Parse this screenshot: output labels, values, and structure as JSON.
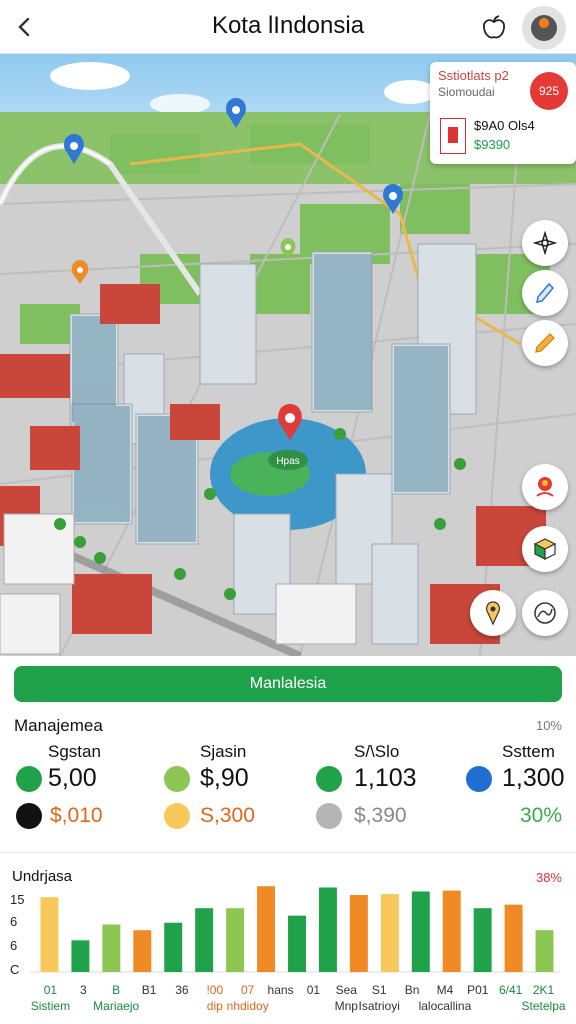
{
  "header": {
    "back_icon": "chevron-left-icon",
    "title": "Kota lIndonsia",
    "apple_icon": "apple-icon",
    "avatar_icon": "avatar-icon"
  },
  "map": {
    "center_pin_label": "Hpas",
    "info_card": {
      "title": "Sstiotlats p2",
      "subtitle": "Siomoudai",
      "badge": "925",
      "item_name": "$9A0 Ols4",
      "item_price": "$9390"
    },
    "side_buttons": [
      "compass-icon",
      "pencil-icon",
      "edit-icon",
      "location-person-icon",
      "cube-icon",
      "map-pin-icon",
      "route-icon"
    ]
  },
  "panel": {
    "cta_label": "Manlalesia",
    "section_title": "Manajemea",
    "section_pct": "10%",
    "stats": [
      {
        "label": "Sgstan",
        "value": "5,00",
        "sub": "$,010",
        "dot": "#1fa24a",
        "sub_dot": "#111111",
        "sub_color": "#e0661a"
      },
      {
        "label": "Sjasin",
        "value": "$,90",
        "sub": "S,300",
        "dot": "#8cc653",
        "sub_dot": "#f7c85a",
        "sub_color": "#e0661a"
      },
      {
        "label": "S/\\Slo",
        "value": "1,103",
        "sub": "$,390",
        "dot": "#1fa24a",
        "sub_dot": "#b5b5b5",
        "sub_color": "#888888"
      },
      {
        "label": "Ssttem",
        "value": "1,300",
        "sub": "30%",
        "dot": "#1e6fd1",
        "sub_dot": "",
        "sub_color": "#3aab49"
      }
    ]
  },
  "chart": {
    "title": "Undrjasa",
    "pct": "38%"
  },
  "chart_data": {
    "type": "bar",
    "title": "Undrjasa",
    "y_ticks": [
      "15",
      "6",
      "6",
      "C"
    ],
    "ylim": [
      0,
      20
    ],
    "bars": [
      {
        "value": 17,
        "color": "#f7c85a"
      },
      {
        "value": 7.2,
        "color": "#1fa24a"
      },
      {
        "value": 10.8,
        "color": "#8cc653"
      },
      {
        "value": 9.5,
        "color": "#f08a24"
      },
      {
        "value": 11.2,
        "color": "#1fa24a"
      },
      {
        "value": 14.5,
        "color": "#1fa24a"
      },
      {
        "value": 14.5,
        "color": "#8cc653"
      },
      {
        "value": 19.5,
        "color": "#f08a24"
      },
      {
        "value": 12.8,
        "color": "#1fa24a"
      },
      {
        "value": 19.2,
        "color": "#1fa24a"
      },
      {
        "value": 17.5,
        "color": "#f08a24"
      },
      {
        "value": 17.7,
        "color": "#f7c85a"
      },
      {
        "value": 18.3,
        "color": "#1fa24a"
      },
      {
        "value": 18.5,
        "color": "#f08a24"
      },
      {
        "value": 14.5,
        "color": "#1fa24a"
      },
      {
        "value": 15.3,
        "color": "#f08a24"
      },
      {
        "value": 9.5,
        "color": "#8cc653"
      }
    ],
    "x_labels": [
      {
        "top": "01",
        "bottom": "Sistiem",
        "color": "#1a8a3c"
      },
      {
        "top": "3",
        "bottom": "",
        "color": "#333333"
      },
      {
        "top": "B",
        "bottom": "Mariaejo",
        "color": "#1a8a3c"
      },
      {
        "top": "B1",
        "bottom": "",
        "color": "#333333"
      },
      {
        "top": "36",
        "bottom": "",
        "color": "#333333"
      },
      {
        "top": "!00",
        "bottom": "dip",
        "color": "#e0661a"
      },
      {
        "top": "07",
        "bottom": "nhdidoy",
        "color": "#e0661a"
      },
      {
        "top": "hans",
        "bottom": "",
        "color": "#333333"
      },
      {
        "top": "01",
        "bottom": "",
        "color": "#333333"
      },
      {
        "top": "Sea",
        "bottom": "Mnp",
        "color": "#333333"
      },
      {
        "top": "S1",
        "bottom": "Isatrioyi",
        "color": "#333333"
      },
      {
        "top": "Bn",
        "bottom": "",
        "color": "#333333"
      },
      {
        "top": "M4",
        "bottom": "lalocallina",
        "color": "#333333"
      },
      {
        "top": "P01",
        "bottom": "",
        "color": "#333333"
      },
      {
        "top": "6/41",
        "bottom": "",
        "color": "#1a8a3c"
      },
      {
        "top": "2K1",
        "bottom": "Stetelpa",
        "color": "#1a8a3c"
      }
    ]
  }
}
